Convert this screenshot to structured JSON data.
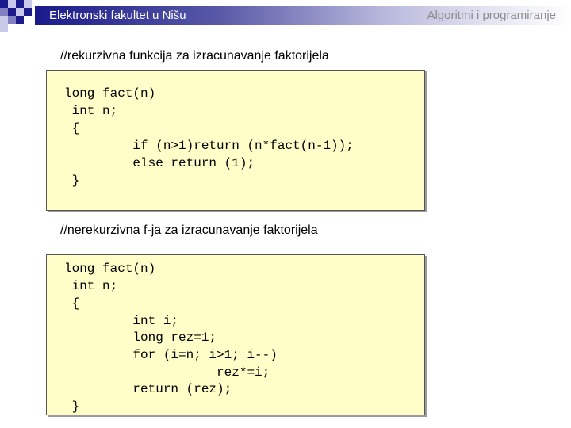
{
  "header": {
    "left_title": "Elektronski fakultet u Nišu",
    "right_title": "Algoritmi i programiranje"
  },
  "sections": [
    {
      "comment": "//rekurzivna funkcija za izracunavanje faktorijela",
      "code": [
        "long fact(n)",
        " int n;",
        " {",
        "         if (n>1)return (n*fact(n-1));",
        "         else return (1);",
        " }"
      ]
    },
    {
      "comment": "//nerekurzivna f-ja za izracunavanje faktorijela",
      "code": [
        "long fact(n)",
        " int n;",
        " {",
        "         int i;",
        "         long rez=1;",
        "         for (i=n; i>1; i--)",
        "                    rez*=i;",
        "         return (rez);",
        " }"
      ]
    }
  ]
}
